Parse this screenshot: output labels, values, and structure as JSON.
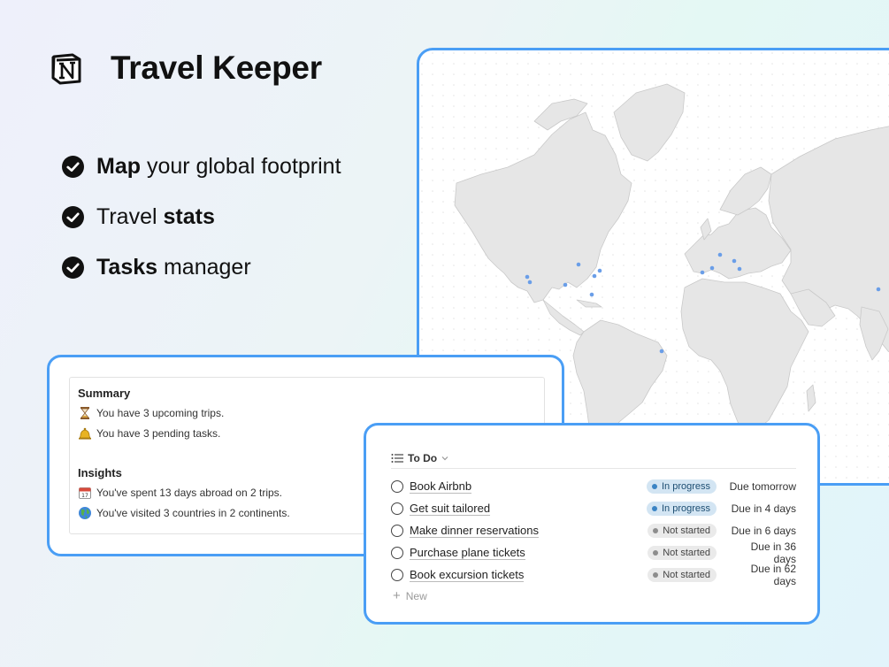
{
  "header": {
    "logo_icon": "notion-logo-icon",
    "title": "Travel Keeper"
  },
  "features": [
    {
      "icon": "check-circle-icon",
      "bold": "Map",
      "rest": " your global footprint",
      "bold_first": true
    },
    {
      "icon": "check-circle-icon",
      "plain": "Travel ",
      "bold": "stats",
      "bold_first": false
    },
    {
      "icon": "check-circle-icon",
      "bold": "Tasks",
      "rest": " manager",
      "bold_first": true
    }
  ],
  "map": {
    "description_icon": "world-map",
    "marker_color": "#6a9ee8"
  },
  "summary": {
    "summary_heading": "Summary",
    "summary_lines": [
      {
        "icon": "hourglass-icon",
        "text": "You have 3 upcoming trips."
      },
      {
        "icon": "bell-icon",
        "text": "You have 3 pending tasks."
      }
    ],
    "insights_heading": "Insights",
    "insights_lines": [
      {
        "icon": "calendar-icon",
        "text": "You've spent 13 days abroad on 2 trips."
      },
      {
        "icon": "globe-icon",
        "text": "You've visited 3 countries in 2 continents."
      }
    ]
  },
  "todo": {
    "view_label": "To Do",
    "view_icon": "list-icon",
    "rows": [
      {
        "name": "Book Airbnb",
        "status": "In progress",
        "status_kind": "prog",
        "due": "Due tomorrow"
      },
      {
        "name": "Get suit tailored",
        "status": "In progress",
        "status_kind": "prog",
        "due": "Due in 4 days"
      },
      {
        "name": "Make dinner reservations",
        "status": "Not started",
        "status_kind": "not",
        "due": "Due in 6 days"
      },
      {
        "name": "Purchase plane tickets",
        "status": "Not started",
        "status_kind": "not",
        "due": "Due in 36 days"
      },
      {
        "name": "Book excursion tickets",
        "status": "Not started",
        "status_kind": "not",
        "due": "Due in 62 days"
      }
    ],
    "new_label": "New"
  },
  "colors": {
    "accent_border": "#4a9ef5",
    "in_progress_bg": "#d3e5f3",
    "not_started_bg": "#eaeaea"
  }
}
